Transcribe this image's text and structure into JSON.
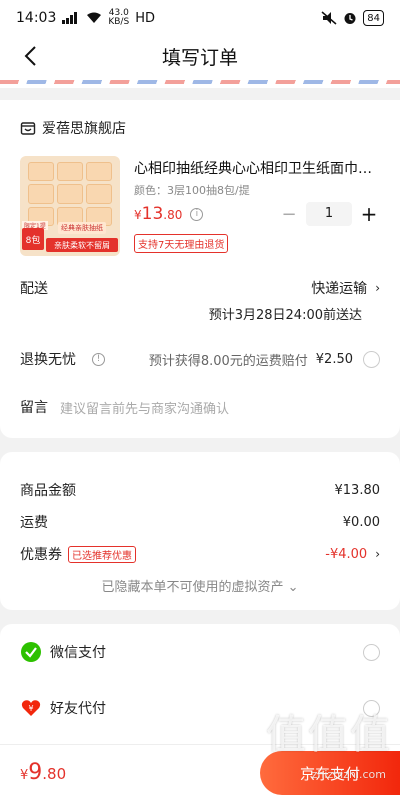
{
  "status_bar": {
    "time": "14:03",
    "signal_label": "5G",
    "speed_value": "43.0",
    "speed_unit": "KB/S",
    "hd": "HD",
    "battery": "84"
  },
  "nav": {
    "title": "填写订单"
  },
  "store": {
    "name": "爱蓓思旗舰店"
  },
  "product": {
    "title": "心相印抽纸经典心心相印卫生纸面巾…",
    "spec": "颜色：3层100抽8包/提",
    "price_symbol": "¥",
    "price_int": "13",
    "price_dec": ".80",
    "quantity": "1",
    "return_tag": "支持7天无理由退货",
    "thumb_badge_left": "8包",
    "thumb_banner": "亲肤柔软不留屑",
    "thumb_small_tag": "经典亲肤抽纸",
    "thumb_top_tag": "限定1提"
  },
  "delivery": {
    "label": "配送",
    "method": "快递运输",
    "eta": "预计3月28日24:00前送达"
  },
  "exchange": {
    "label": "退换无忧",
    "desc": "预计获得8.00元的运费赔付",
    "price": "¥2.50"
  },
  "message": {
    "label": "留言",
    "placeholder": "建议留言前先与商家沟通确认"
  },
  "summary": {
    "goods_label": "商品金额",
    "goods_value": "¥13.80",
    "shipping_label": "运费",
    "shipping_value": "¥0.00",
    "coupon_label": "优惠券",
    "coupon_tag": "已选推荐优惠",
    "coupon_value": "-¥4.00",
    "hidden_note": "已隐藏本单不可使用的虚拟资产 ⌄"
  },
  "payment": {
    "wechat_label": "微信支付",
    "friend_label": "好友代付"
  },
  "bottom": {
    "total_symbol": "¥",
    "total_int": "9",
    "total_dec": ".80",
    "pay_button": "京东支付"
  },
  "watermark": {
    "main": "值值值",
    "sub": "zhizhizhi.com"
  },
  "colors": {
    "accent": "#e4322b",
    "wechat": "#2dc100",
    "page_bg": "#f2f2f2"
  }
}
